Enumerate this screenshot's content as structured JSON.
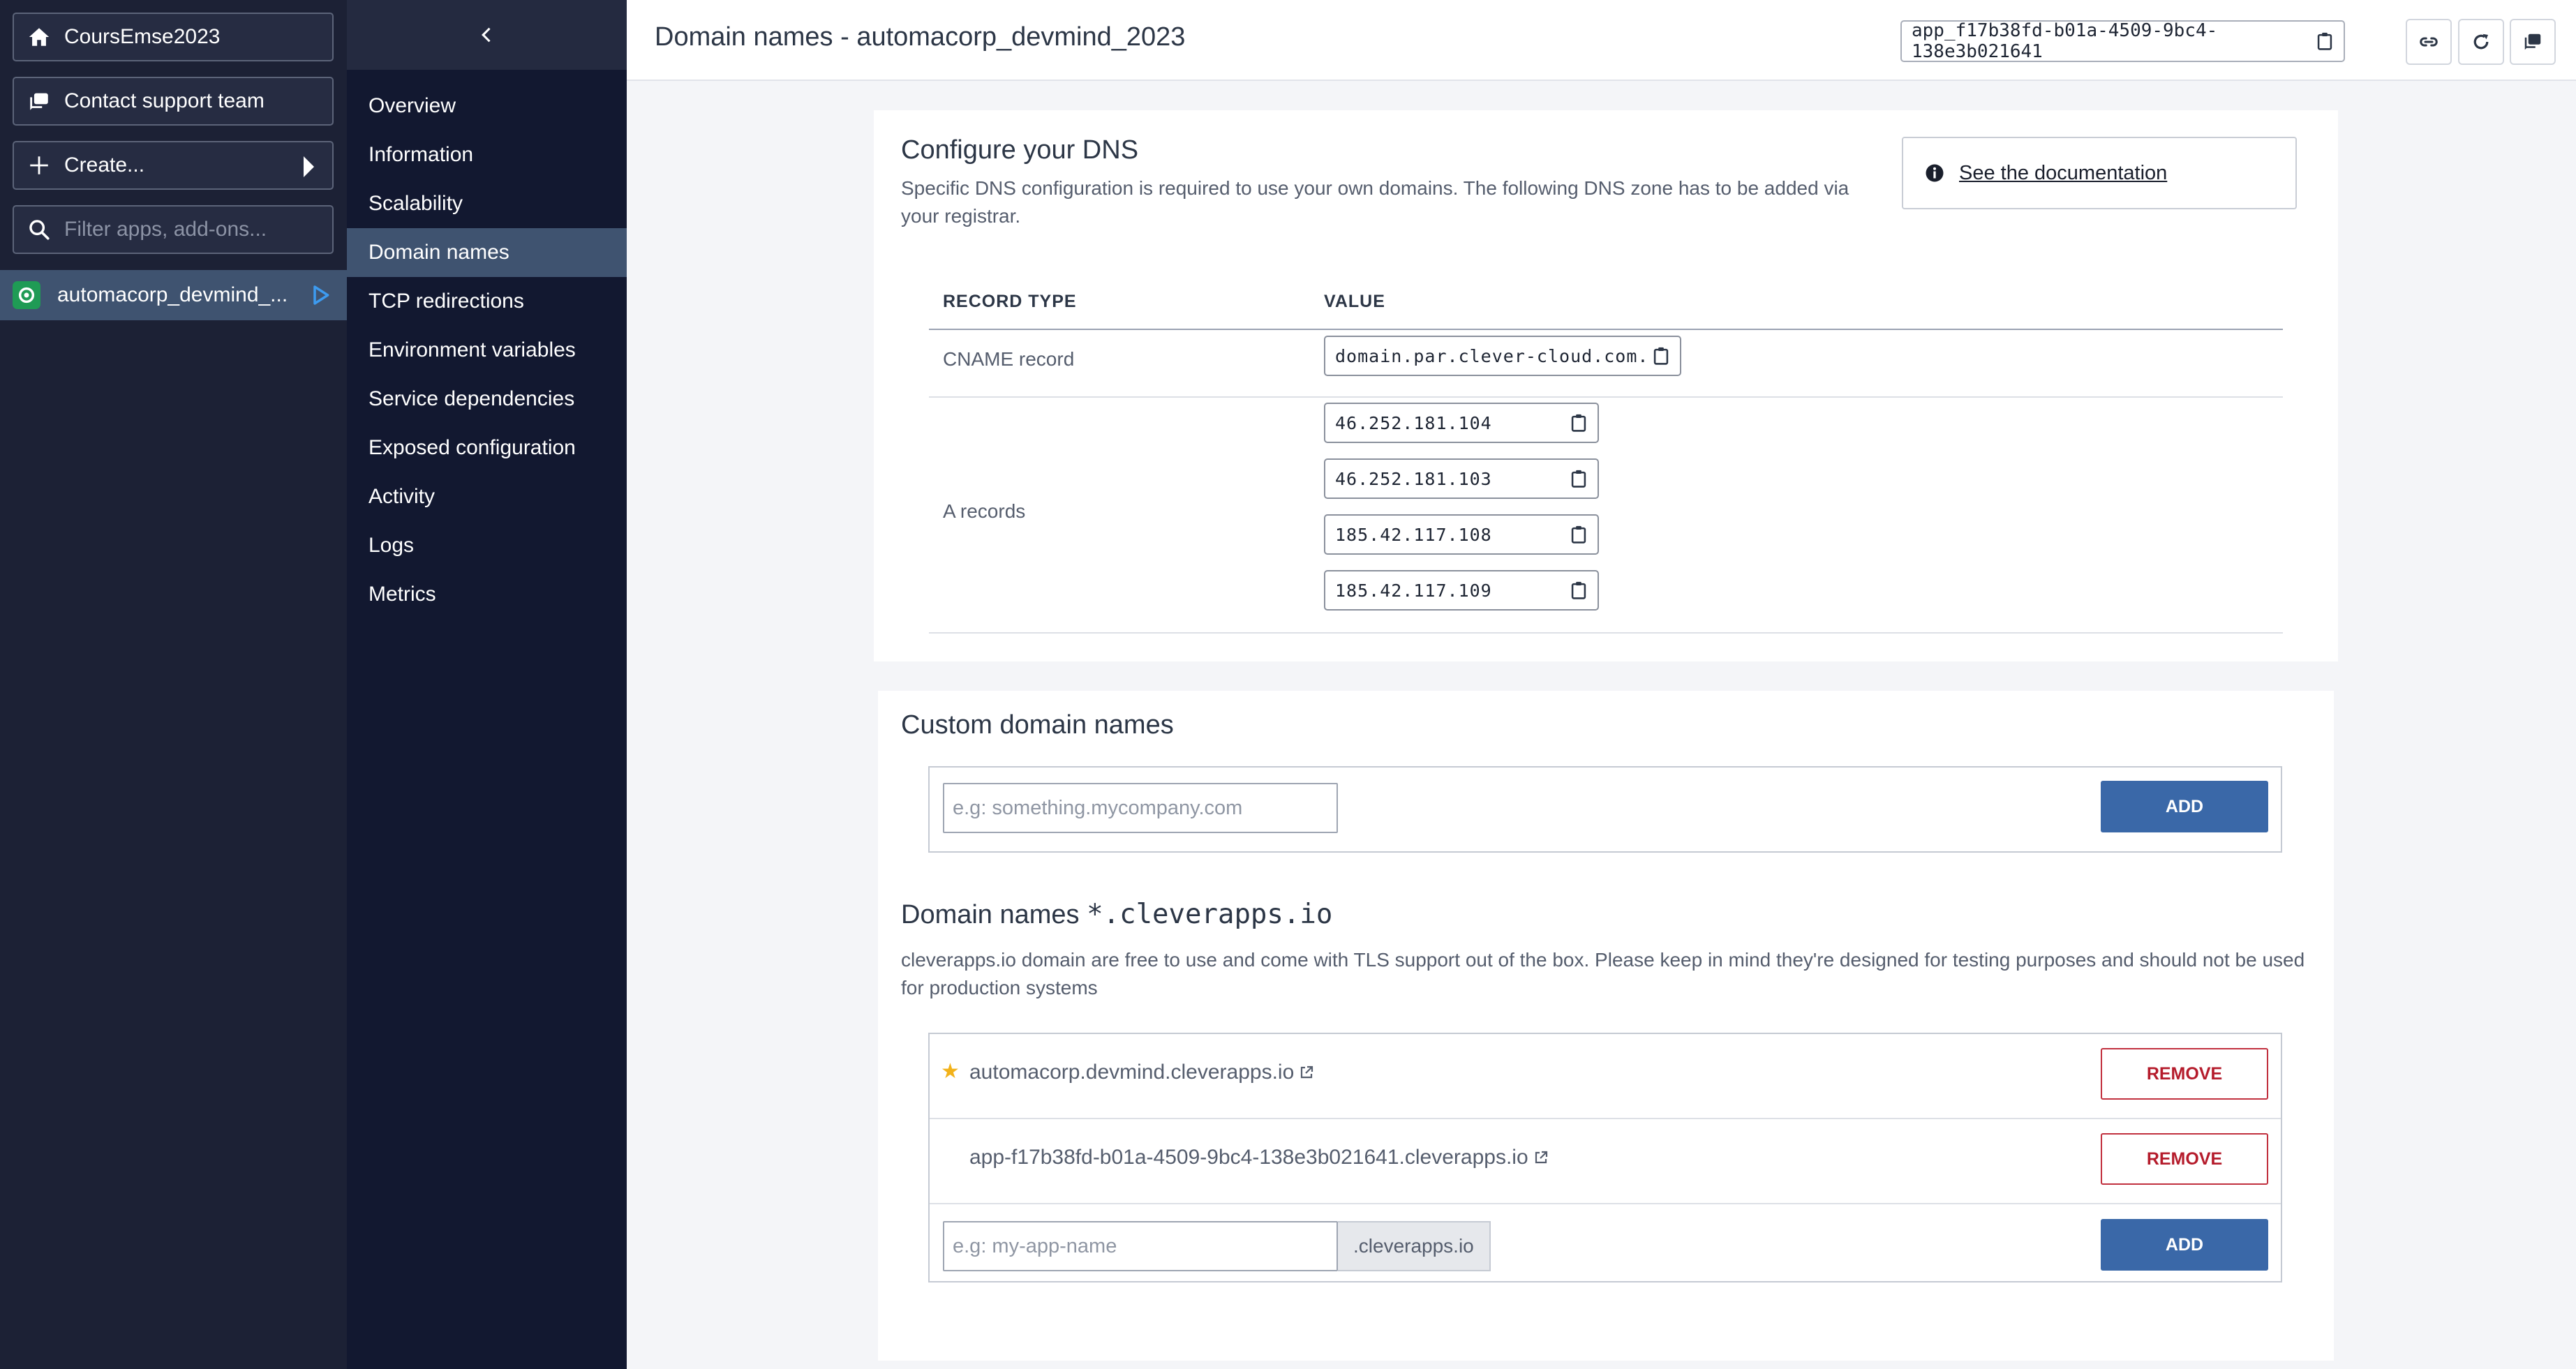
{
  "sidebar": {
    "org_name": "CoursEmse2023",
    "support_label": "Contact support team",
    "create_label": "Create...",
    "filter_placeholder": "Filter apps, add-ons...",
    "app_name": "automacorp_devmind_..."
  },
  "app_nav": {
    "items": [
      {
        "label": "Overview"
      },
      {
        "label": "Information"
      },
      {
        "label": "Scalability"
      },
      {
        "label": "Domain names",
        "active": true
      },
      {
        "label": "TCP redirections"
      },
      {
        "label": "Environment variables"
      },
      {
        "label": "Service dependencies"
      },
      {
        "label": "Exposed configuration"
      },
      {
        "label": "Activity"
      },
      {
        "label": "Logs"
      },
      {
        "label": "Metrics"
      }
    ]
  },
  "header": {
    "title": "Domain names - automacorp_devmind_2023",
    "app_id": "app_f17b38fd-b01a-4509-9bc4-138e3b021641"
  },
  "dns": {
    "title": "Configure your DNS",
    "description": "Specific DNS configuration is required to use your own domains. The following DNS zone has to be added via your registrar.",
    "doc_link": "See the documentation",
    "col_record_type": "RECORD TYPE",
    "col_value": "VALUE",
    "cname_label": "CNAME record",
    "cname_value": "domain.par.clever-cloud.com.",
    "a_label": "A records",
    "a_values": [
      "46.252.181.104",
      "46.252.181.103",
      "185.42.117.108",
      "185.42.117.109"
    ]
  },
  "custom_domains": {
    "title": "Custom domain names",
    "placeholder": "e.g: something.mycompany.com",
    "add_label": "ADD"
  },
  "cleverapps": {
    "title_prefix": "Domain names",
    "title_code": "*.cleverapps.io",
    "description": "cleverapps.io domain are free to use and come with TLS support out of the box. Please keep in mind they're designed for testing purposes and should not be used for production systems",
    "domains": [
      {
        "name": "automacorp.devmind.cleverapps.io",
        "primary": true,
        "action": "REMOVE"
      },
      {
        "name": "app-f17b38fd-b01a-4509-9bc4-138e3b021641.cleverapps.io",
        "primary": false,
        "action": "REMOVE"
      }
    ],
    "placeholder": "e.g: my-app-name",
    "suffix": ".cleverapps.io",
    "add_label": "ADD"
  },
  "colors": {
    "sidebar_bg": "#1c2135",
    "nav_bg": "#121830",
    "active_bg": "#3f5370",
    "primary_button": "#3a68a8",
    "danger": "#c1303e",
    "star": "#f2b21a"
  }
}
